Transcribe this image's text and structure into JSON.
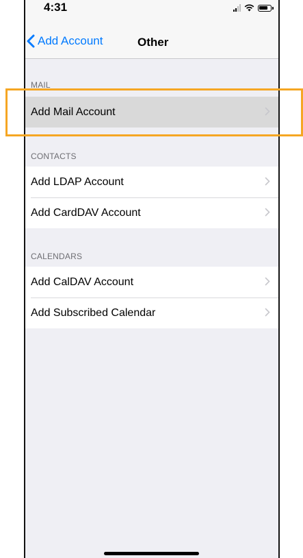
{
  "status_bar": {
    "time": "4:31"
  },
  "nav": {
    "back_label": "Add Account",
    "title": "Other"
  },
  "sections": {
    "mail": {
      "header": "MAIL",
      "items": [
        {
          "label": "Add Mail Account"
        }
      ]
    },
    "contacts": {
      "header": "CONTACTS",
      "items": [
        {
          "label": "Add LDAP Account"
        },
        {
          "label": "Add CardDAV Account"
        }
      ]
    },
    "calendars": {
      "header": "CALENDARS",
      "items": [
        {
          "label": "Add CalDAV Account"
        },
        {
          "label": "Add Subscribed Calendar"
        }
      ]
    }
  },
  "colors": {
    "accent": "#007aff",
    "highlight_frame": "#f5a623",
    "background": "#efeff4"
  },
  "icons": [
    "chevron-left-icon",
    "chevron-right-icon",
    "signal-icon",
    "wifi-icon",
    "battery-icon"
  ]
}
